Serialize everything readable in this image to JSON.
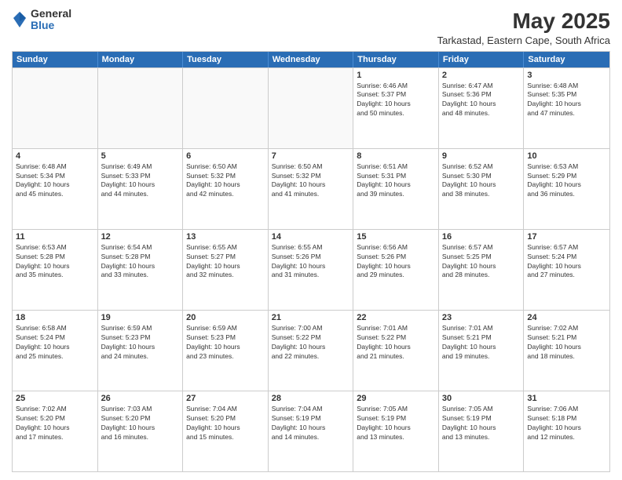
{
  "logo": {
    "general": "General",
    "blue": "Blue"
  },
  "title": "May 2025",
  "subtitle": "Tarkastad, Eastern Cape, South Africa",
  "days_of_week": [
    "Sunday",
    "Monday",
    "Tuesday",
    "Wednesday",
    "Thursday",
    "Friday",
    "Saturday"
  ],
  "weeks": [
    [
      {
        "day": "",
        "info": ""
      },
      {
        "day": "",
        "info": ""
      },
      {
        "day": "",
        "info": ""
      },
      {
        "day": "",
        "info": ""
      },
      {
        "day": "1",
        "info": "Sunrise: 6:46 AM\nSunset: 5:37 PM\nDaylight: 10 hours\nand 50 minutes."
      },
      {
        "day": "2",
        "info": "Sunrise: 6:47 AM\nSunset: 5:36 PM\nDaylight: 10 hours\nand 48 minutes."
      },
      {
        "day": "3",
        "info": "Sunrise: 6:48 AM\nSunset: 5:35 PM\nDaylight: 10 hours\nand 47 minutes."
      }
    ],
    [
      {
        "day": "4",
        "info": "Sunrise: 6:48 AM\nSunset: 5:34 PM\nDaylight: 10 hours\nand 45 minutes."
      },
      {
        "day": "5",
        "info": "Sunrise: 6:49 AM\nSunset: 5:33 PM\nDaylight: 10 hours\nand 44 minutes."
      },
      {
        "day": "6",
        "info": "Sunrise: 6:50 AM\nSunset: 5:32 PM\nDaylight: 10 hours\nand 42 minutes."
      },
      {
        "day": "7",
        "info": "Sunrise: 6:50 AM\nSunset: 5:32 PM\nDaylight: 10 hours\nand 41 minutes."
      },
      {
        "day": "8",
        "info": "Sunrise: 6:51 AM\nSunset: 5:31 PM\nDaylight: 10 hours\nand 39 minutes."
      },
      {
        "day": "9",
        "info": "Sunrise: 6:52 AM\nSunset: 5:30 PM\nDaylight: 10 hours\nand 38 minutes."
      },
      {
        "day": "10",
        "info": "Sunrise: 6:53 AM\nSunset: 5:29 PM\nDaylight: 10 hours\nand 36 minutes."
      }
    ],
    [
      {
        "day": "11",
        "info": "Sunrise: 6:53 AM\nSunset: 5:28 PM\nDaylight: 10 hours\nand 35 minutes."
      },
      {
        "day": "12",
        "info": "Sunrise: 6:54 AM\nSunset: 5:28 PM\nDaylight: 10 hours\nand 33 minutes."
      },
      {
        "day": "13",
        "info": "Sunrise: 6:55 AM\nSunset: 5:27 PM\nDaylight: 10 hours\nand 32 minutes."
      },
      {
        "day": "14",
        "info": "Sunrise: 6:55 AM\nSunset: 5:26 PM\nDaylight: 10 hours\nand 31 minutes."
      },
      {
        "day": "15",
        "info": "Sunrise: 6:56 AM\nSunset: 5:26 PM\nDaylight: 10 hours\nand 29 minutes."
      },
      {
        "day": "16",
        "info": "Sunrise: 6:57 AM\nSunset: 5:25 PM\nDaylight: 10 hours\nand 28 minutes."
      },
      {
        "day": "17",
        "info": "Sunrise: 6:57 AM\nSunset: 5:24 PM\nDaylight: 10 hours\nand 27 minutes."
      }
    ],
    [
      {
        "day": "18",
        "info": "Sunrise: 6:58 AM\nSunset: 5:24 PM\nDaylight: 10 hours\nand 25 minutes."
      },
      {
        "day": "19",
        "info": "Sunrise: 6:59 AM\nSunset: 5:23 PM\nDaylight: 10 hours\nand 24 minutes."
      },
      {
        "day": "20",
        "info": "Sunrise: 6:59 AM\nSunset: 5:23 PM\nDaylight: 10 hours\nand 23 minutes."
      },
      {
        "day": "21",
        "info": "Sunrise: 7:00 AM\nSunset: 5:22 PM\nDaylight: 10 hours\nand 22 minutes."
      },
      {
        "day": "22",
        "info": "Sunrise: 7:01 AM\nSunset: 5:22 PM\nDaylight: 10 hours\nand 21 minutes."
      },
      {
        "day": "23",
        "info": "Sunrise: 7:01 AM\nSunset: 5:21 PM\nDaylight: 10 hours\nand 19 minutes."
      },
      {
        "day": "24",
        "info": "Sunrise: 7:02 AM\nSunset: 5:21 PM\nDaylight: 10 hours\nand 18 minutes."
      }
    ],
    [
      {
        "day": "25",
        "info": "Sunrise: 7:02 AM\nSunset: 5:20 PM\nDaylight: 10 hours\nand 17 minutes."
      },
      {
        "day": "26",
        "info": "Sunrise: 7:03 AM\nSunset: 5:20 PM\nDaylight: 10 hours\nand 16 minutes."
      },
      {
        "day": "27",
        "info": "Sunrise: 7:04 AM\nSunset: 5:20 PM\nDaylight: 10 hours\nand 15 minutes."
      },
      {
        "day": "28",
        "info": "Sunrise: 7:04 AM\nSunset: 5:19 PM\nDaylight: 10 hours\nand 14 minutes."
      },
      {
        "day": "29",
        "info": "Sunrise: 7:05 AM\nSunset: 5:19 PM\nDaylight: 10 hours\nand 13 minutes."
      },
      {
        "day": "30",
        "info": "Sunrise: 7:05 AM\nSunset: 5:19 PM\nDaylight: 10 hours\nand 13 minutes."
      },
      {
        "day": "31",
        "info": "Sunrise: 7:06 AM\nSunset: 5:18 PM\nDaylight: 10 hours\nand 12 minutes."
      }
    ]
  ]
}
